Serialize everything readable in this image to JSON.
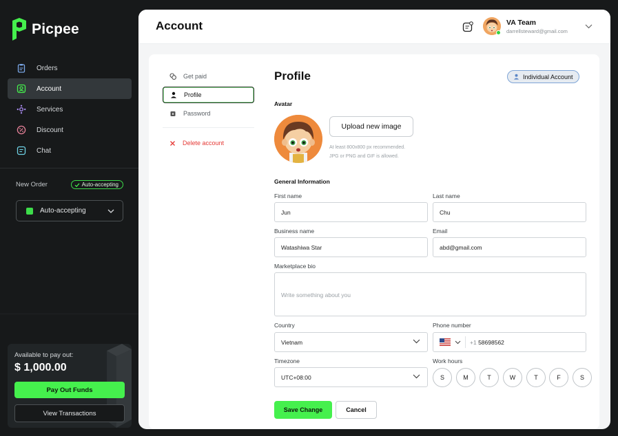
{
  "app": {
    "name": "Picpee"
  },
  "sidebar": {
    "items": [
      {
        "label": "Orders",
        "icon": "clipboard-icon"
      },
      {
        "label": "Account",
        "icon": "user-square-icon"
      },
      {
        "label": "Services",
        "icon": "services-icon"
      },
      {
        "label": "Discount",
        "icon": "discount-icon"
      },
      {
        "label": "Chat",
        "icon": "chat-icon"
      }
    ],
    "new_order_label": "New Order",
    "auto_badge": "Auto-accepting",
    "auto_select_value": "Auto-accepting",
    "payout": {
      "label": "Available to pay out:",
      "amount": "$ 1,000.00",
      "pay_button": "Pay Out Funds",
      "view_button": "View Transactions"
    }
  },
  "header": {
    "title": "Account",
    "user_name": "VA Team",
    "user_email": "darrellsteward@gmail.com"
  },
  "subnav": {
    "items": [
      {
        "label": "Get paid"
      },
      {
        "label": "Profile"
      },
      {
        "label": "Password"
      }
    ],
    "delete_label": "Delete account"
  },
  "profile": {
    "title": "Profile",
    "account_badge": "Individual Account",
    "avatar_label": "Avatar",
    "upload_button": "Upload new image",
    "hint_line1": "At least 800x800 px recommended.",
    "hint_line2": "JPG or PNG and GIF is allowed.",
    "section_title": "General Information",
    "first_name_label": "First name",
    "first_name": "Jun",
    "last_name_label": "Last name",
    "last_name": "Chu",
    "business_label": "Business name",
    "business_name": "Watashiwa Star",
    "email_label": "Email",
    "email": "abd@gmail.com",
    "bio_label": "Marketplace bio",
    "bio_placeholder": "Write something about you",
    "country_label": "Country",
    "country": "Vietnam",
    "phone_label": "Phone number",
    "phone_code": "+1",
    "phone_number": "58698562",
    "timezone_label": "Timezone",
    "timezone": "UTC+08:00",
    "work_hours_label": "Work hours",
    "days": [
      "S",
      "M",
      "T",
      "W",
      "T",
      "F",
      "S"
    ],
    "save_button": "Save Change",
    "cancel_button": "Cancel"
  },
  "colors": {
    "accent_green": "#45f04d",
    "sidebar_bg": "#17191a",
    "danger": "#e53935"
  }
}
